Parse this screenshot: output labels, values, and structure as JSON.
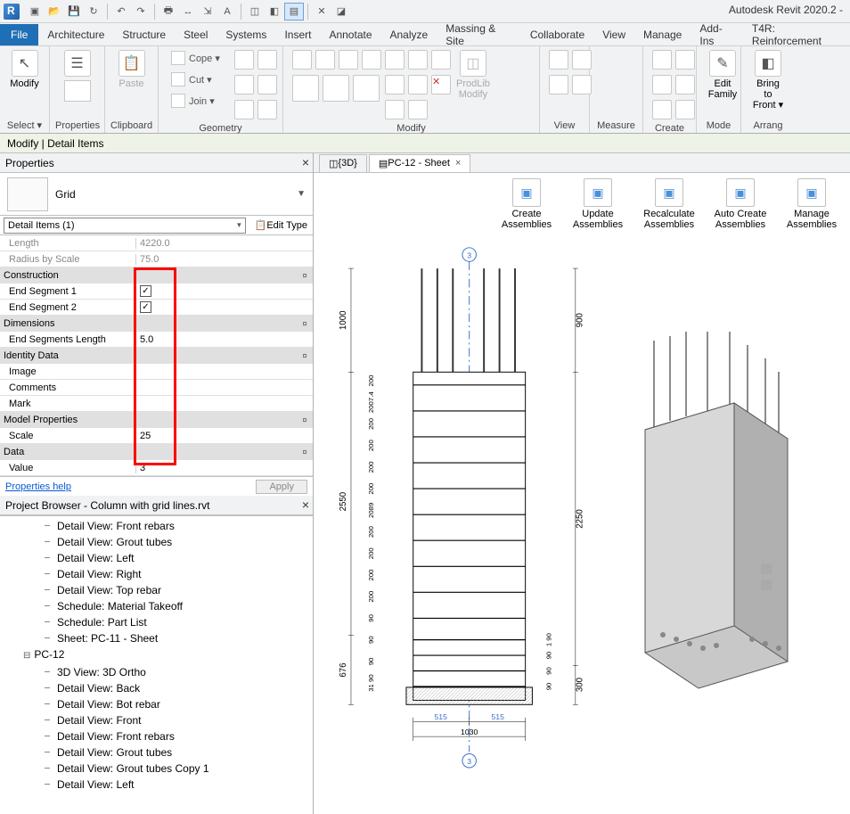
{
  "app_title": "Autodesk Revit 2020.2 -",
  "menu_file": "File",
  "menus": [
    "Architecture",
    "Structure",
    "Steel",
    "Systems",
    "Insert",
    "Annotate",
    "Analyze",
    "Massing & Site",
    "Collaborate",
    "View",
    "Manage",
    "Add-Ins",
    "T4R: Reinforcement"
  ],
  "context_label": "Modify | Detail Items",
  "ribbon": {
    "select": {
      "modify": "Modify",
      "select": "Select ▾",
      "label": "Select"
    },
    "props": {
      "btn": "Properties",
      "label": "Properties"
    },
    "clipboard": {
      "paste": "Paste",
      "cope": "Cope ▾",
      "cut": "Cut ▾",
      "join": "Join ▾",
      "label": "Clipboard"
    },
    "geometry": {
      "label": "Geometry"
    },
    "modify": {
      "label": "Modify",
      "prodlib": "ProdLib\nModify"
    },
    "view": {
      "label": "View"
    },
    "measure": {
      "label": "Measure"
    },
    "create": {
      "label": "Create"
    },
    "mode": {
      "edit": "Edit\nFamily",
      "label": "Mode"
    },
    "arrange": {
      "bring": "Bring to\nFront ▾",
      "label": "Arrang"
    }
  },
  "properties": {
    "title": "Properties",
    "type_name": "Grid",
    "combo": "Detail Items (1)",
    "edit_type": "Edit Type",
    "rows": [
      {
        "n": "Length",
        "v": "4220.0",
        "cat": false,
        "dim": true
      },
      {
        "n": "Radius by Scale",
        "v": "75.0",
        "cat": false,
        "dim": true
      },
      {
        "n": "Construction",
        "v": "",
        "cat": true
      },
      {
        "n": "End Segment 1",
        "v": "[check]",
        "cat": false
      },
      {
        "n": "End Segment 2",
        "v": "[check]",
        "cat": false
      },
      {
        "n": "Dimensions",
        "v": "",
        "cat": true
      },
      {
        "n": "End Segments Length",
        "v": "5.0",
        "cat": false
      },
      {
        "n": "Identity Data",
        "v": "",
        "cat": true
      },
      {
        "n": "Image",
        "v": "",
        "cat": false
      },
      {
        "n": "Comments",
        "v": "",
        "cat": false
      },
      {
        "n": "Mark",
        "v": "",
        "cat": false
      },
      {
        "n": "Model Properties",
        "v": "",
        "cat": true
      },
      {
        "n": "Scale",
        "v": "25",
        "cat": false
      },
      {
        "n": "Data",
        "v": "",
        "cat": true
      },
      {
        "n": "Value",
        "v": "3",
        "cat": false
      }
    ],
    "help": "Properties help",
    "apply": "Apply"
  },
  "browser": {
    "title": "Project Browser - Column with grid lines.rvt",
    "items_top": [
      "Detail View: Front rebars",
      "Detail View: Grout tubes",
      "Detail View: Left",
      "Detail View: Right",
      "Detail View: Top rebar",
      "Schedule: Material Takeoff",
      "Schedule: Part List",
      "Sheet: PC-11 - Sheet"
    ],
    "parent": "PC-12",
    "items_child": [
      "3D View: 3D Ortho",
      "Detail View: Back",
      "Detail View: Bot rebar",
      "Detail View: Front",
      "Detail View: Front rebars",
      "Detail View: Grout tubes",
      "Detail View: Grout tubes Copy 1",
      "Detail View: Left"
    ]
  },
  "tabs": {
    "t1": "{3D}",
    "t2": "PC-12 - Sheet"
  },
  "assemblies": [
    {
      "l1": "Create",
      "l2": "Assemblies"
    },
    {
      "l1": "Update",
      "l2": "Assemblies"
    },
    {
      "l1": "Recalculate",
      "l2": "Assemblies"
    },
    {
      "l1": "Auto Create",
      "l2": "Assemblies"
    },
    {
      "l1": "Manage",
      "l2": "Assemblies"
    }
  ],
  "dims": {
    "v_left_out": [
      "1000",
      "2550",
      "676"
    ],
    "v_left_in": [
      "200",
      "2007.4",
      "200",
      "200",
      "200",
      "200",
      "2089",
      "200",
      "200",
      "200",
      "200",
      "90",
      "90",
      "90",
      "31 90"
    ],
    "v_right_out": [
      "900",
      "2250",
      "300"
    ],
    "v_right_in": [
      "1 90",
      "90",
      "90",
      "90"
    ],
    "h_bot": [
      "515",
      "515"
    ],
    "h_total": "1030",
    "grid": "3"
  }
}
